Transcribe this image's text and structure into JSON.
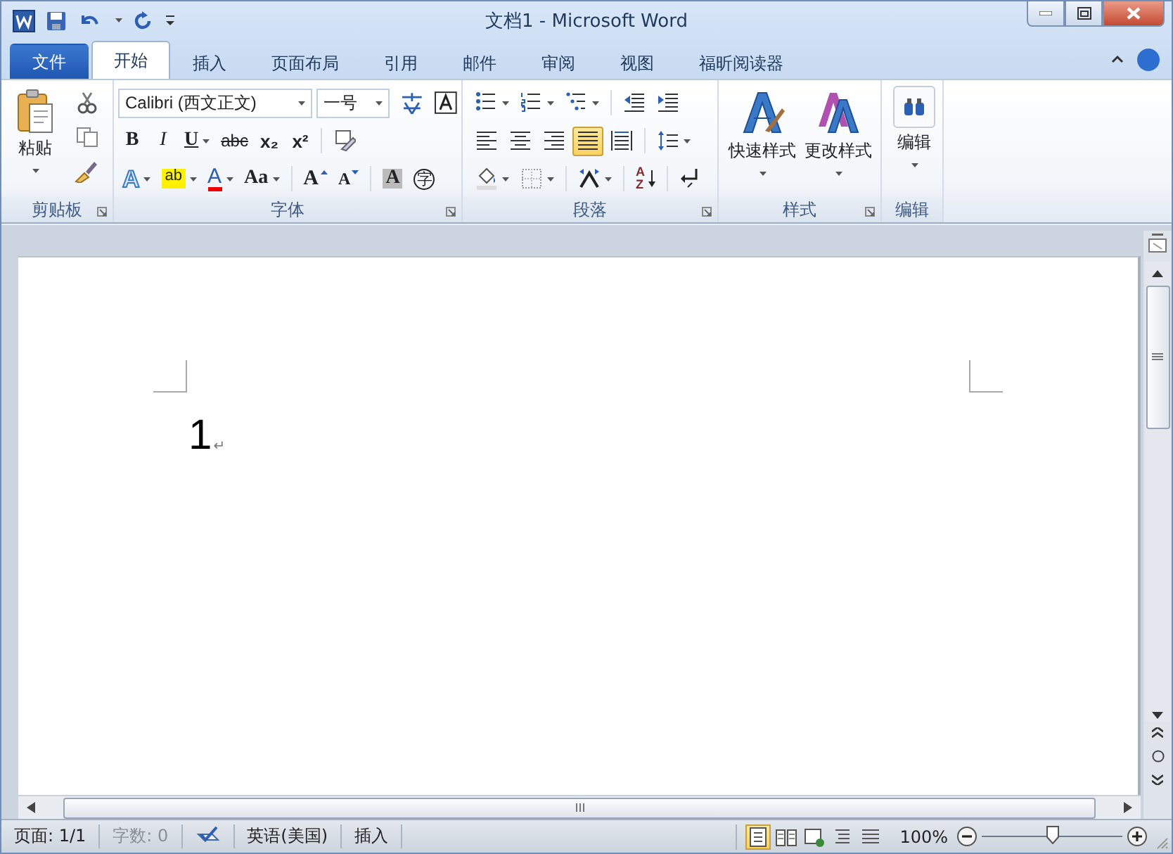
{
  "window": {
    "title": "文档1 - Microsoft Word"
  },
  "tabs": [
    {
      "label": "文件",
      "kind": "file",
      "selected": false
    },
    {
      "label": "开始",
      "kind": "tab",
      "selected": true
    },
    {
      "label": "插入",
      "kind": "tab",
      "selected": false
    },
    {
      "label": "页面布局",
      "kind": "tab",
      "selected": false
    },
    {
      "label": "引用",
      "kind": "tab",
      "selected": false
    },
    {
      "label": "邮件",
      "kind": "tab",
      "selected": false
    },
    {
      "label": "审阅",
      "kind": "tab",
      "selected": false
    },
    {
      "label": "视图",
      "kind": "tab",
      "selected": false
    },
    {
      "label": "福昕阅读器",
      "kind": "tab",
      "selected": false
    }
  ],
  "ribbon": {
    "clipboard": {
      "label": "剪贴板",
      "paste": "粘贴"
    },
    "font": {
      "label": "字体",
      "font_name": "Calibri (西文正文)",
      "font_size": "一号",
      "rows": [
        [
          {
            "kind": "bold",
            "label": "B",
            "menu": false
          },
          {
            "kind": "italic",
            "label": "I",
            "menu": false
          },
          {
            "kind": "underline",
            "label": "U",
            "menu": true
          },
          {
            "kind": "strike",
            "label": "abc",
            "menu": false
          },
          {
            "kind": "sub",
            "label": "x₂",
            "menu": false
          },
          {
            "kind": "sup",
            "label": "x²",
            "menu": false
          },
          {
            "kind": "sep"
          },
          {
            "kind": "clear",
            "menu": false
          }
        ],
        [
          {
            "kind": "effects",
            "label": "A",
            "menu": true
          },
          {
            "kind": "highlight",
            "label": "ab",
            "menu": true
          },
          {
            "kind": "color",
            "label": "A",
            "menu": true
          },
          {
            "kind": "case",
            "label": "Aa",
            "menu": true
          },
          {
            "kind": "sep"
          },
          {
            "kind": "grow",
            "label": "A",
            "menu": false
          },
          {
            "kind": "shrink",
            "label": "A",
            "menu": false
          },
          {
            "kind": "sep"
          },
          {
            "kind": "shade",
            "label": "A",
            "menu": false
          },
          {
            "kind": "enclose",
            "label": "字",
            "menu": false
          }
        ]
      ]
    },
    "paragraph": {
      "label": "段落",
      "rows": [
        [
          {
            "kind": "bullets",
            "menu": true
          },
          {
            "kind": "numbering",
            "menu": true
          },
          {
            "kind": "multilevel",
            "menu": true
          },
          {
            "kind": "sep"
          },
          {
            "kind": "outdent",
            "menu": false
          },
          {
            "kind": "indent",
            "menu": false
          }
        ],
        [
          {
            "kind": "align-left",
            "menu": false,
            "selected": false
          },
          {
            "kind": "align-center",
            "menu": false,
            "selected": false
          },
          {
            "kind": "align-right",
            "menu": false,
            "selected": false
          },
          {
            "kind": "justify",
            "menu": false,
            "selected": true
          },
          {
            "kind": "distribute",
            "menu": false,
            "selected": false
          },
          {
            "kind": "sep"
          },
          {
            "kind": "spacing",
            "menu": true,
            "selected": false
          }
        ],
        [
          {
            "kind": "fill",
            "menu": true
          },
          {
            "kind": "borders",
            "menu": true
          },
          {
            "kind": "sep"
          },
          {
            "kind": "asian",
            "menu": true
          },
          {
            "kind": "sep"
          },
          {
            "kind": "sort",
            "label": "AZ",
            "menu": false
          },
          {
            "kind": "sep"
          },
          {
            "kind": "marks",
            "menu": false
          }
        ]
      ]
    },
    "styles": {
      "label": "样式",
      "buttons": [
        {
          "label": "快速样式",
          "kind": "quick"
        },
        {
          "label": "更改样式",
          "kind": "change"
        }
      ]
    },
    "editing": {
      "label": "编辑",
      "button": "编辑"
    }
  },
  "document": {
    "text": "1",
    "paragraph_mark": "↵"
  },
  "status_bar": {
    "items": [
      {
        "label": "页面: 1/1",
        "disabled": false,
        "kind": "text"
      },
      {
        "label": "字数: 0",
        "disabled": true,
        "kind": "text"
      },
      {
        "kind": "proof"
      },
      {
        "label": "英语(美国)",
        "disabled": false,
        "kind": "text"
      },
      {
        "label": "插入",
        "disabled": false,
        "kind": "text"
      }
    ],
    "views": [
      {
        "kind": "print",
        "selected": true
      },
      {
        "kind": "reading",
        "selected": false
      },
      {
        "kind": "web",
        "selected": false
      },
      {
        "kind": "outline",
        "selected": false
      },
      {
        "kind": "draft",
        "selected": false
      }
    ],
    "zoom": "100%",
    "zoom_slider": {
      "level": 0.5
    }
  }
}
